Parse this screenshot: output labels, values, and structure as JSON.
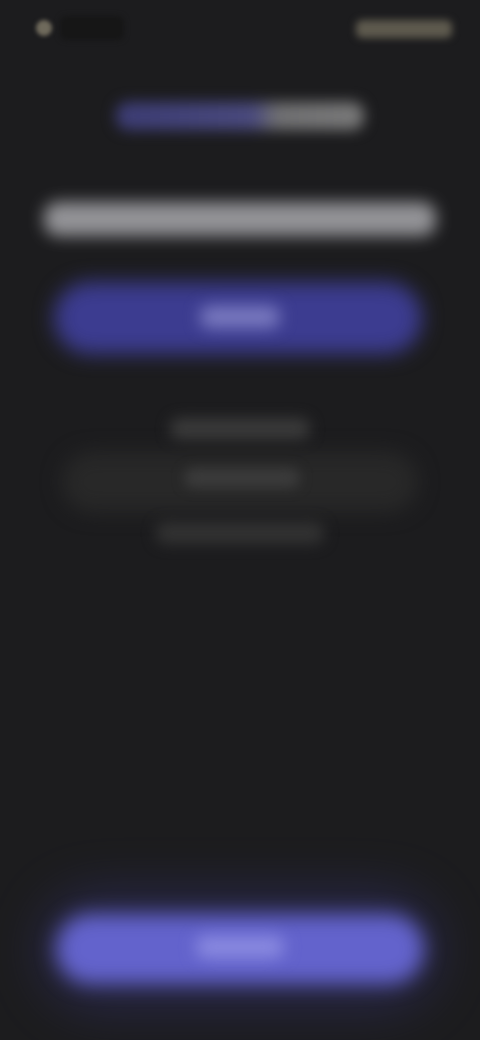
{
  "colors": {
    "background": "#1c1c1e",
    "accent": "#6363cc",
    "accent_dark": "#3c3c90",
    "card": "#282828"
  },
  "icons": {
    "status_left": "signal-dot-icon"
  }
}
